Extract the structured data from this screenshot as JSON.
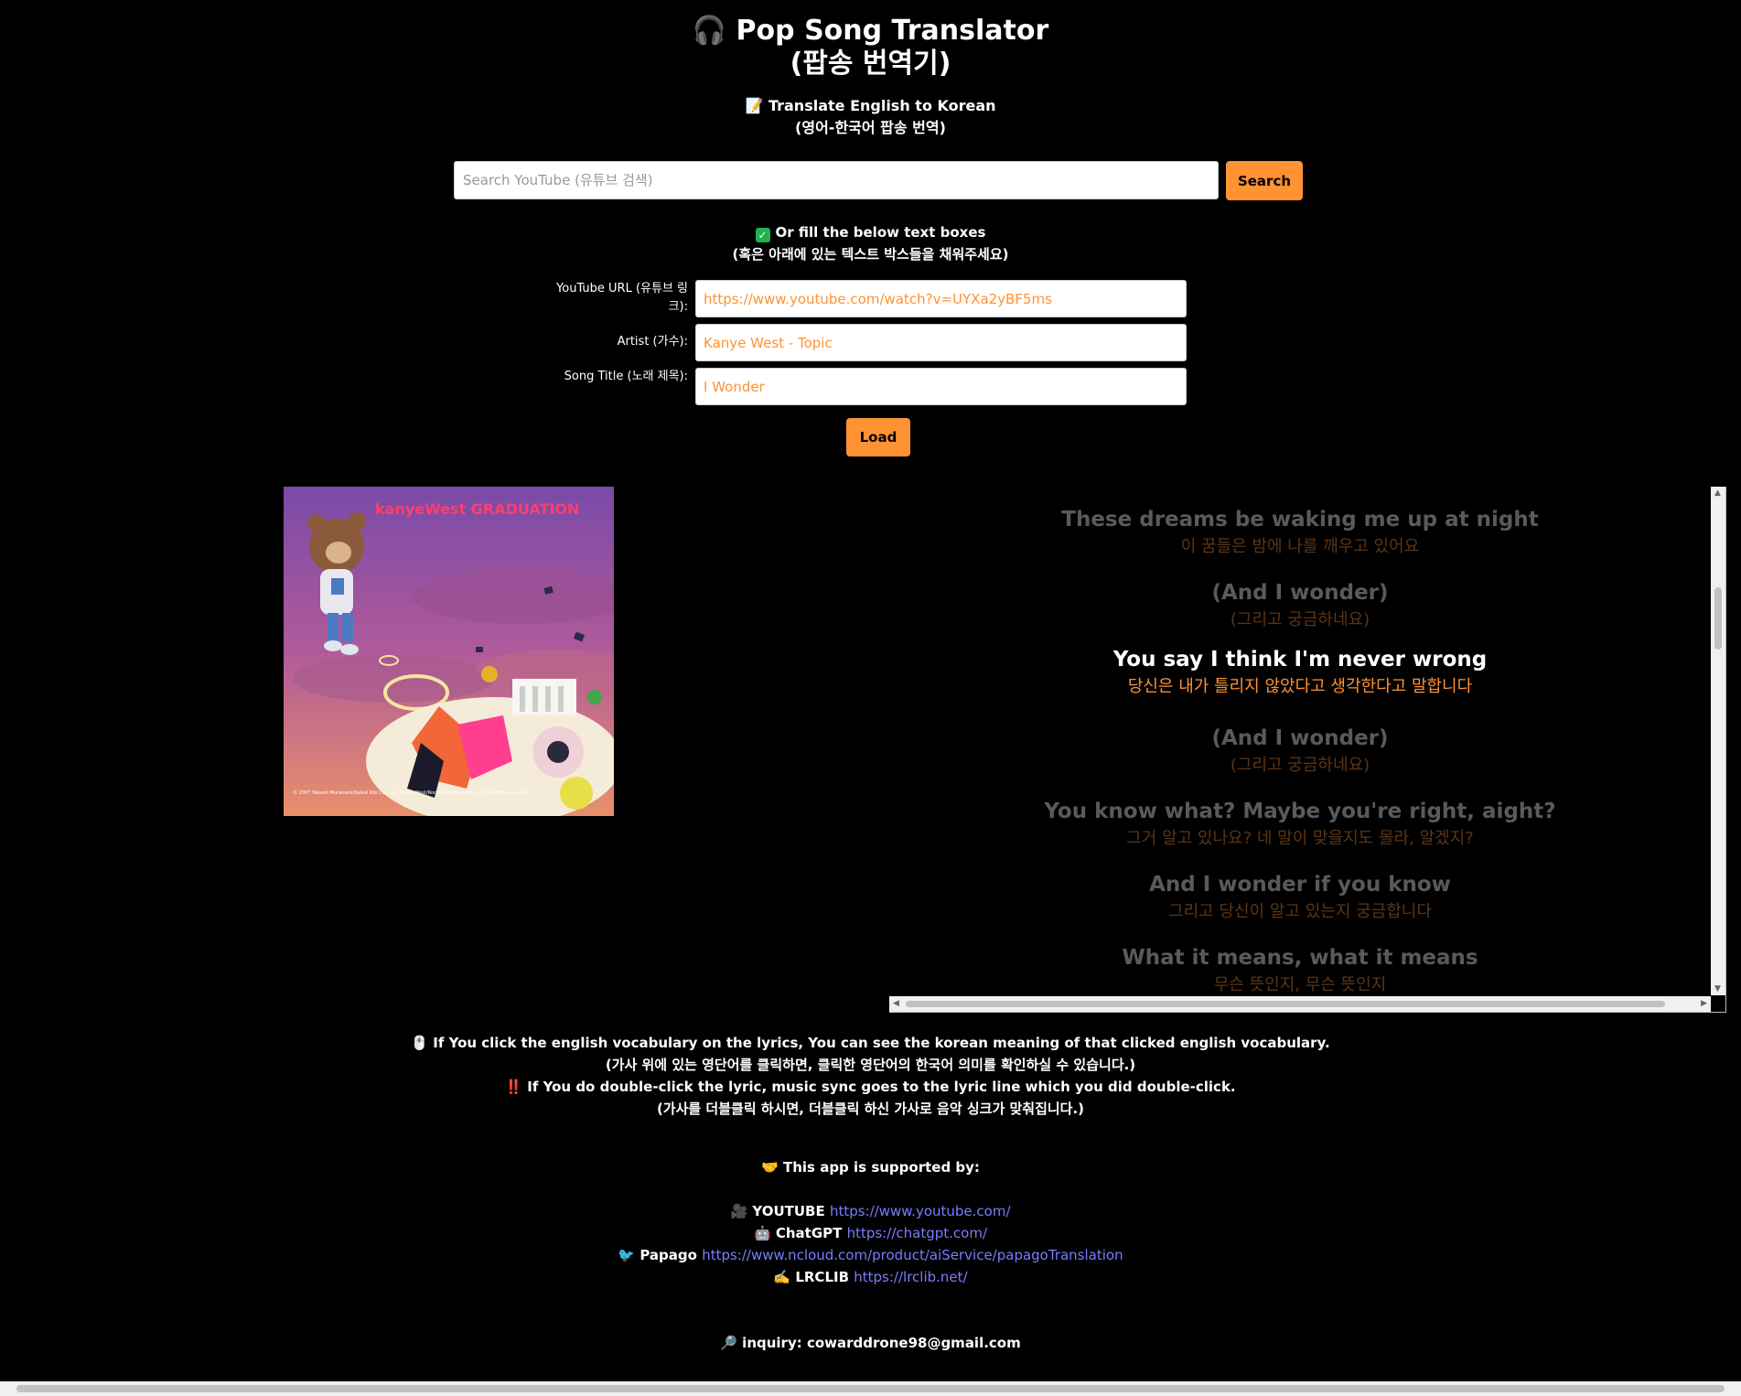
{
  "header": {
    "title_line1": "Pop Song Translator",
    "title_line2": "(팝송 번역기)",
    "subtitle_line1": "Translate English to Korean",
    "subtitle_line2": "(영어-한국어 팝송 번역)",
    "title_icon": "headphones-icon",
    "subtitle_icon": "memo-icon"
  },
  "search": {
    "placeholder": "Search YouTube (유튜브 검색)",
    "button_label": "Search"
  },
  "fill_note": {
    "line1": "Or fill the below text boxes",
    "line2": "(혹은 아래에 있는 텍스트 박스들을 채워주세요)"
  },
  "form": {
    "url_label": "YouTube URL (유튜브 링크):",
    "url_value": "https://www.youtube.com/watch?v=UYXa2yBF5ms",
    "artist_label": "Artist (가수):",
    "artist_value": "Kanye West - Topic",
    "title_label": "Song Title (노래 제목):",
    "title_value": "I Wonder",
    "load_label": "Load"
  },
  "album": {
    "cover_text": "kanyeWest GRADUATION",
    "copyright": "© 2007 Takashi Murakami/Kaikai Kiki Co., Ltd. Kanye West/Roc-A-Fella Records, LLC All rights reserved."
  },
  "lyrics": [
    {
      "en": "These dreams be waking me up at night",
      "ko": "이 꿈들은 밤에 나를 깨우고 있어요",
      "state": "dim"
    },
    {
      "en": "(And I wonder)",
      "ko": "(그리고 궁금하네요)",
      "state": "dim"
    },
    {
      "en": "You say I think I'm never wrong",
      "ko": "당신은 내가 틀리지 않았다고 생각한다고 말합니다",
      "state": "active"
    },
    {
      "en": "(And I wonder)",
      "ko": "(그리고 궁금하네요)",
      "state": "dim"
    },
    {
      "en": "You know what? Maybe you're right, aight?",
      "ko": "그거 알고 있나요? 네 말이 맞을지도 몰라, 알겠지?",
      "state": "dim"
    },
    {
      "en": "And I wonder if you know",
      "ko": "그리고 당신이 알고 있는지 궁금합니다",
      "state": "dim"
    },
    {
      "en": "What it means, what it means",
      "ko": "무슨 뜻인지, 무슨 뜻인지",
      "state": "dim"
    }
  ],
  "help": {
    "line1": "If You click the english vocabulary on the lyrics, You can see the korean meaning of that clicked english vocabulary.",
    "line2": "(가사 위에 있는 영단어를 클릭하면, 클릭한 영단어의 한국어 의미를 확인하실 수 있습니다.)",
    "line3": "If You do double-click the lyric, music sync goes to the lyric line which you did double-click.",
    "line4": "(가사를 더블클릭 하시면, 더블클릭 하신 가사로 음악 싱크가 맞춰집니다.)"
  },
  "support": {
    "heading": "This app is supported by:",
    "sources": [
      {
        "name": "YOUTUBE",
        "url": "https://www.youtube.com/",
        "icon": "camera-icon"
      },
      {
        "name": "ChatGPT",
        "url": "https://chatgpt.com/",
        "icon": "robot-icon"
      },
      {
        "name": "Papago",
        "url": "https://www.ncloud.com/product/aiService/papagoTranslation",
        "icon": "bird-icon"
      },
      {
        "name": "LRCLIB",
        "url": "https://lrclib.net/",
        "icon": "writing-hand-icon"
      }
    ]
  },
  "inquiry": {
    "label": "inquiry:",
    "email": "cowarddrone98@gmail.com"
  },
  "colors": {
    "accent": "#ff9233",
    "link": "#7b7bff",
    "background": "#000000"
  }
}
